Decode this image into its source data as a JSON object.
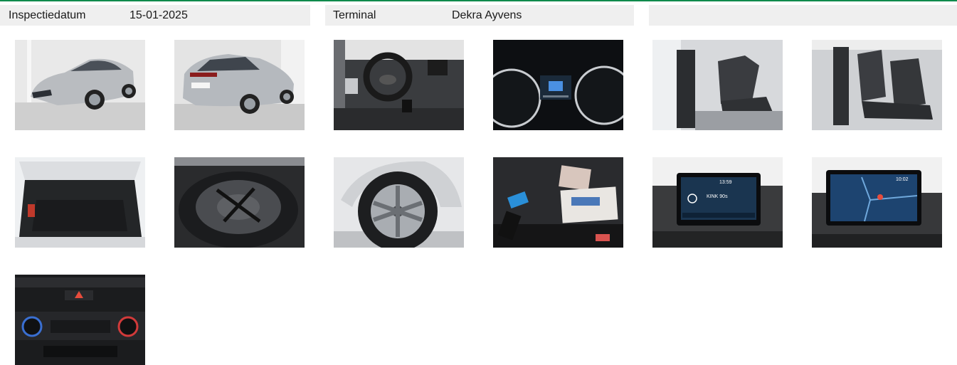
{
  "header": {
    "date_label": "Inspectiedatum",
    "date_value": "15-01-2025",
    "terminal_label": "Terminal",
    "terminal_value": "Dekra Ayvens"
  },
  "photos": [
    {
      "name": "photo-front-left-exterior",
      "icon": "car-exterior"
    },
    {
      "name": "photo-rear-right-exterior",
      "icon": "car-exterior"
    },
    {
      "name": "photo-dashboard",
      "icon": "steering-wheel"
    },
    {
      "name": "photo-instrument-cluster",
      "icon": "gauge"
    },
    {
      "name": "photo-front-seats",
      "icon": "car-seat"
    },
    {
      "name": "photo-rear-seats",
      "icon": "car-seat"
    },
    {
      "name": "photo-trunk",
      "icon": "trunk"
    },
    {
      "name": "photo-spare-wheel",
      "icon": "wheel"
    },
    {
      "name": "photo-alloy-wheel",
      "icon": "wheel"
    },
    {
      "name": "photo-keys-and-manuals",
      "icon": "key"
    },
    {
      "name": "photo-infotainment-radio",
      "icon": "screen"
    },
    {
      "name": "photo-infotainment-navigation",
      "icon": "map"
    },
    {
      "name": "photo-climate-controls",
      "icon": "climate"
    }
  ],
  "screen_text": {
    "radio_time": "13:59",
    "radio_station": "KINK 90s",
    "nav_time": "10:02"
  },
  "colors": {
    "accent": "#0f8a4c",
    "header_bg": "#efefef"
  }
}
